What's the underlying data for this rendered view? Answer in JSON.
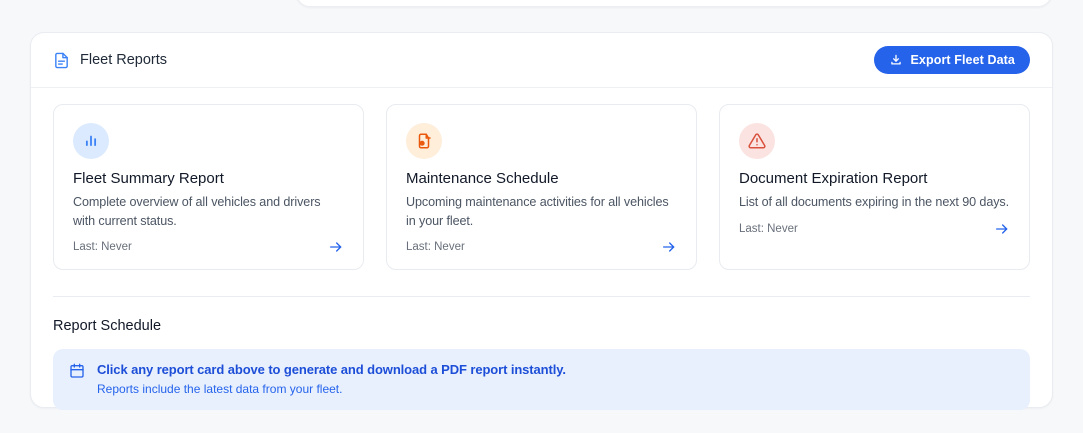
{
  "page": {
    "background": "#f6f8fa"
  },
  "panel": {
    "header": {
      "title": "Fleet Reports",
      "title_icon": "file-text-icon",
      "export_button": {
        "label": "Export Fleet Data",
        "icon": "download-icon",
        "color": "#2563eb"
      }
    },
    "reports": [
      {
        "title": "Fleet Summary Report",
        "description": "Complete overview of all vehicles and drivers with current status.",
        "last_label": "Last: Never",
        "icon": "bar-chart-icon",
        "icon_color": "#3b82f6",
        "icon_bg": "#dbeafe"
      },
      {
        "title": "Maintenance Schedule",
        "description": "Upcoming maintenance activities for all vehicles in your fleet.",
        "last_label": "Last: Never",
        "icon": "file-cog-icon",
        "icon_color": "#ea580c",
        "icon_bg": "#feeeda"
      },
      {
        "title": "Document Expiration Report",
        "description": "List of all documents expiring in the next 90 days.",
        "last_label": "Last: Never",
        "icon": "alert-triangle-icon",
        "icon_color": "#d9503c",
        "icon_bg": "#fbe3e1"
      }
    ],
    "arrow_color": "#2563eb",
    "schedule": {
      "title": "Report Schedule",
      "banner": {
        "icon": "calendar-icon",
        "headline": "Click any report card above to generate and download a PDF report instantly.",
        "subtext": "Reports include the latest data from your fleet.",
        "background": "#e8f0fd"
      }
    }
  }
}
